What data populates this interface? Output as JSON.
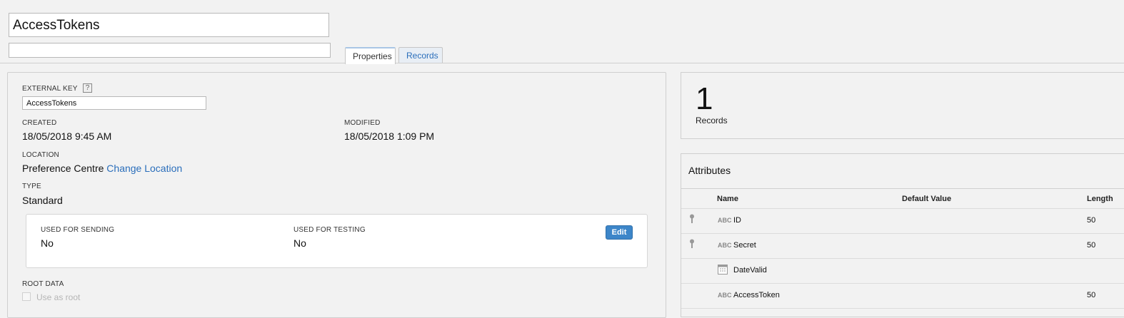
{
  "header": {
    "title": "AccessTokens",
    "description": ""
  },
  "tabs": [
    {
      "label": "Properties",
      "active": true
    },
    {
      "label": "Records",
      "active": false
    }
  ],
  "properties": {
    "external_key_label": "EXTERNAL KEY",
    "help_glyph": "?",
    "external_key_value": "AccessTokens",
    "created_label": "CREATED",
    "created_value": "18/05/2018 9:45 AM",
    "modified_label": "MODIFIED",
    "modified_value": "18/05/2018 1:09 PM",
    "location_label": "LOCATION",
    "location_value": "Preference Centre",
    "change_location_link": "Change Location",
    "type_label": "TYPE",
    "type_value": "Standard",
    "sending_label": "USED FOR SENDING",
    "sending_value": "No",
    "testing_label": "USED FOR TESTING",
    "testing_value": "No",
    "edit_label": "Edit",
    "root_label": "ROOT DATA",
    "use_as_root_label": "Use as root"
  },
  "records": {
    "count": "1",
    "label": "Records"
  },
  "attributes": {
    "title": "Attributes",
    "columns": [
      "Name",
      "Default Value",
      "Length"
    ],
    "rows": [
      {
        "name": "ID",
        "icon": "abc-text-icon",
        "primary_key": true,
        "length": "50"
      },
      {
        "name": "Secret",
        "icon": "abc-text-icon",
        "primary_key": true,
        "length": "50"
      },
      {
        "name": "DateValid",
        "icon": "calendar-icon",
        "primary_key": false,
        "length": ""
      },
      {
        "name": "AccessToken",
        "icon": "abc-text-icon",
        "primary_key": false,
        "length": "50"
      }
    ],
    "abc_glyph": "ABC"
  },
  "colors": {
    "accent": "#2a6ebb",
    "button": "#3d86c9",
    "background": "#f2f2f2"
  }
}
